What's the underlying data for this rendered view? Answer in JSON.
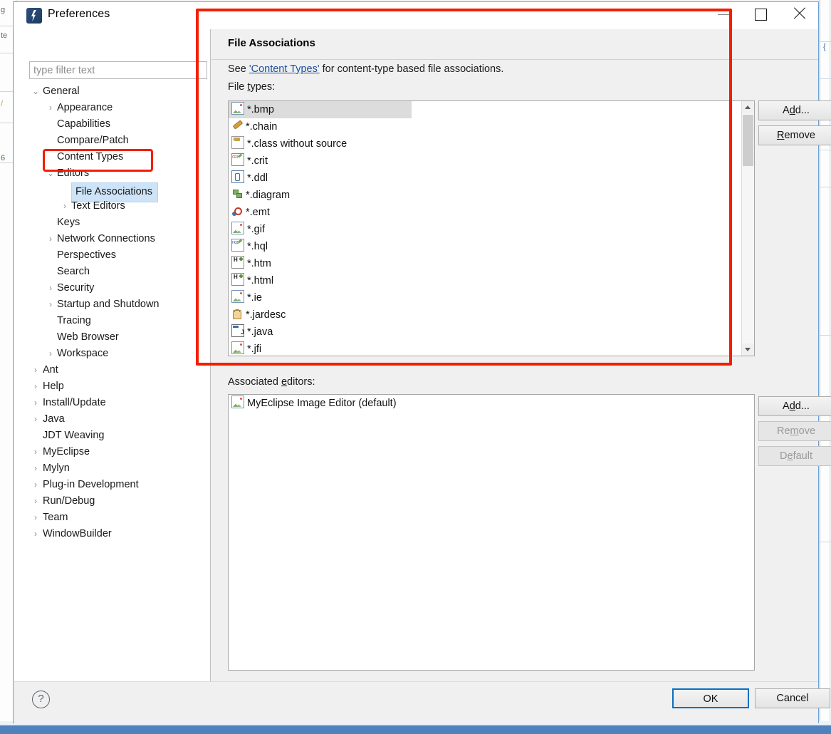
{
  "window": {
    "title": "Preferences",
    "icon": "myeclipse-icon",
    "minimize_label": "",
    "maximize_label": "",
    "close_label": ""
  },
  "filter": {
    "placeholder": "type filter text",
    "value": ""
  },
  "tree": {
    "items": [
      {
        "label": "General",
        "level": 0,
        "twisty": "v",
        "selected": false
      },
      {
        "label": "Appearance",
        "level": 1,
        "twisty": ">",
        "selected": false
      },
      {
        "label": "Capabilities",
        "level": 1,
        "twisty": "",
        "selected": false
      },
      {
        "label": "Compare/Patch",
        "level": 1,
        "twisty": "",
        "selected": false
      },
      {
        "label": "Content Types",
        "level": 1,
        "twisty": "",
        "selected": false
      },
      {
        "label": "Editors",
        "level": 1,
        "twisty": "v",
        "selected": false
      },
      {
        "label": "File Associations",
        "level": 2,
        "twisty": "",
        "selected": true
      },
      {
        "label": "Text Editors",
        "level": 2,
        "twisty": ">",
        "selected": false
      },
      {
        "label": "Keys",
        "level": 1,
        "twisty": "",
        "selected": false
      },
      {
        "label": "Network Connections",
        "level": 1,
        "twisty": ">",
        "selected": false
      },
      {
        "label": "Perspectives",
        "level": 1,
        "twisty": "",
        "selected": false
      },
      {
        "label": "Search",
        "level": 1,
        "twisty": "",
        "selected": false
      },
      {
        "label": "Security",
        "level": 1,
        "twisty": ">",
        "selected": false
      },
      {
        "label": "Startup and Shutdown",
        "level": 1,
        "twisty": ">",
        "selected": false
      },
      {
        "label": "Tracing",
        "level": 1,
        "twisty": "",
        "selected": false
      },
      {
        "label": "Web Browser",
        "level": 1,
        "twisty": "",
        "selected": false
      },
      {
        "label": "Workspace",
        "level": 1,
        "twisty": ">",
        "selected": false
      },
      {
        "label": "Ant",
        "level": 0,
        "twisty": ">",
        "selected": false
      },
      {
        "label": "Help",
        "level": 0,
        "twisty": ">",
        "selected": false
      },
      {
        "label": "Install/Update",
        "level": 0,
        "twisty": ">",
        "selected": false
      },
      {
        "label": "Java",
        "level": 0,
        "twisty": ">",
        "selected": false
      },
      {
        "label": "JDT Weaving",
        "level": 0,
        "twisty": "",
        "selected": false
      },
      {
        "label": "MyEclipse",
        "level": 0,
        "twisty": ">",
        "selected": false
      },
      {
        "label": "Mylyn",
        "level": 0,
        "twisty": ">",
        "selected": false
      },
      {
        "label": "Plug-in Development",
        "level": 0,
        "twisty": ">",
        "selected": false
      },
      {
        "label": "Run/Debug",
        "level": 0,
        "twisty": ">",
        "selected": false
      },
      {
        "label": "Team",
        "level": 0,
        "twisty": ">",
        "selected": false
      },
      {
        "label": "WindowBuilder",
        "level": 0,
        "twisty": ">",
        "selected": false
      }
    ]
  },
  "page": {
    "title": "File Associations",
    "see_prefix": "See ",
    "see_link": "'Content Types'",
    "see_suffix": " for content-type based file associations.",
    "file_types_label_pre": "File ",
    "file_types_label_mnemonic": "t",
    "file_types_label_post": "ypes:",
    "associated_label_pre": "Associated ",
    "associated_label_mnemonic": "e",
    "associated_label_post": "ditors:"
  },
  "file_types": {
    "items": [
      {
        "label": "*.bmp",
        "icon": "image-icon",
        "selected": true
      },
      {
        "label": "*.chain",
        "icon": "chain-icon",
        "selected": false
      },
      {
        "label": "*.class without source",
        "icon": "class-icon",
        "selected": false
      },
      {
        "label": "*.crit",
        "icon": "crit-icon",
        "selected": false
      },
      {
        "label": "*.ddl",
        "icon": "ddl-icon",
        "selected": false
      },
      {
        "label": "*.diagram",
        "icon": "diagram-icon",
        "selected": false
      },
      {
        "label": "*.emt",
        "icon": "emt-icon",
        "selected": false
      },
      {
        "label": "*.gif",
        "icon": "image-icon",
        "selected": false
      },
      {
        "label": "*.hql",
        "icon": "hql-icon",
        "selected": false
      },
      {
        "label": "*.htm",
        "icon": "html-icon",
        "selected": false
      },
      {
        "label": "*.html",
        "icon": "html-icon",
        "selected": false
      },
      {
        "label": "*.ie",
        "icon": "image-icon",
        "selected": false
      },
      {
        "label": "*.jardesc",
        "icon": "jardesc-icon",
        "selected": false
      },
      {
        "label": "*.java",
        "icon": "java-icon",
        "selected": false
      },
      {
        "label": "*.jfi",
        "icon": "image-icon",
        "selected": false
      }
    ],
    "buttons": {
      "add": {
        "pre": "A",
        "mnemonic": "d",
        "post": "d...",
        "enabled": true
      },
      "remove": {
        "pre": "",
        "mnemonic": "R",
        "post": "emove",
        "enabled": true
      }
    }
  },
  "associated_editors": {
    "items": [
      {
        "label": "MyEclipse Image Editor (default)",
        "icon": "image-icon"
      }
    ],
    "buttons": {
      "add": {
        "pre": "A",
        "mnemonic": "d",
        "post": "d...",
        "enabled": true
      },
      "remove": {
        "pre": "Re",
        "mnemonic": "m",
        "post": "ove",
        "enabled": false
      },
      "default": {
        "pre": "D",
        "mnemonic": "e",
        "post": "fault",
        "enabled": false
      }
    }
  },
  "footer": {
    "help_glyph": "?",
    "ok_label": "OK",
    "cancel_label": "Cancel"
  },
  "navigation": {
    "back": "back-arrow",
    "back_dropdown": "chevron-down-icon",
    "forward": "forward-arrow",
    "forward_dropdown": "chevron-down-icon",
    "menu_dropdown": "chevron-down-icon"
  },
  "colors": {
    "accent_blue": "#0a6fc2",
    "selection_blue": "#cde3f7",
    "annotation_red": "#f41d00",
    "link_blue": "#1a4f9c",
    "dialog_bg": "#f0f0f0"
  },
  "background_ide": {
    "left_gutter_marks": [
      "g",
      "te",
      "/",
      "6"
    ]
  }
}
